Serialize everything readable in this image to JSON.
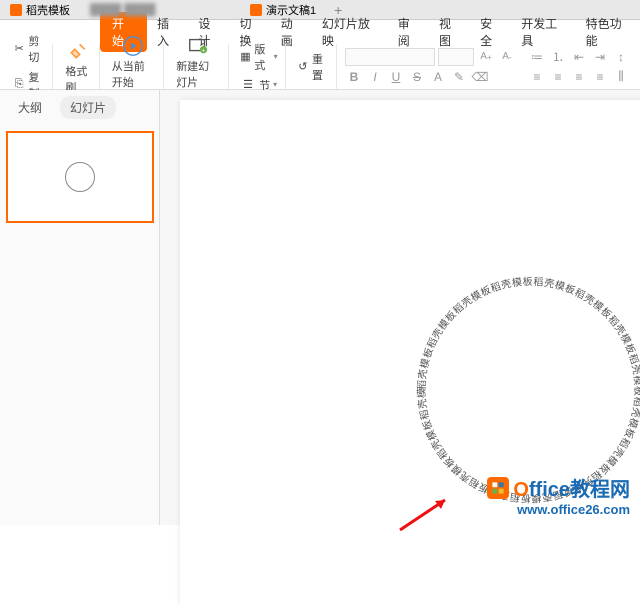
{
  "tabs": {
    "t1": "稻壳模板",
    "t2": "演示文稿1"
  },
  "ribbon": {
    "start": "开始",
    "insert": "插入",
    "design": "设计",
    "transition": "切换",
    "animation": "动画",
    "slideshow": "幻灯片放映",
    "review": "审阅",
    "view": "视图",
    "security": "安全",
    "devtools": "开发工具",
    "special": "特色功能"
  },
  "toolbar": {
    "cut": "剪切",
    "copy": "复制",
    "format_painter": "格式刷",
    "from_current": "从当前开始",
    "new_slide": "新建幻灯片",
    "layout": "版式",
    "section": "节",
    "reset": "重置"
  },
  "fmt": {
    "bold": "B",
    "italic": "I",
    "underline": "U",
    "strike": "S",
    "sup": "A",
    "sub": "A"
  },
  "sidebar": {
    "outline": "大纲",
    "slides": "幻灯片"
  },
  "circle_text": "稻壳模板稻壳模板稻壳模板稻壳模板稻壳模板稻壳模板稻壳模板稻壳模板稻壳模板稻壳模板稻壳模板稻壳模板稻壳模板稻壳模板稻壳模板稻壳模板稻壳模板稻壳模板稻壳模板稻壳模板稻壳",
  "watermark": {
    "brand_o": "O",
    "brand_rest": "ffice教程网",
    "url": "www.office26.com"
  }
}
